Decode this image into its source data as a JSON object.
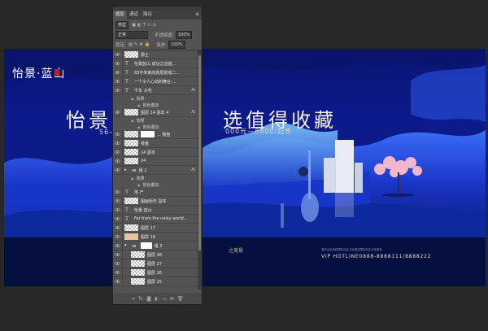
{
  "panel": {
    "tabs": [
      "图层",
      "通道",
      "路径"
    ],
    "filter_kind": "类型",
    "blend_mode": "正常",
    "opacity_label": "不透明度:",
    "opacity_value": "100%",
    "lock_label": "锁定:",
    "fill_label": "填充:",
    "fill_value": "100%",
    "layers": [
      {
        "name": "爵士",
        "type": "thumb"
      },
      {
        "name": "怡景蓝山 成功之选值...",
        "type": "T"
      },
      {
        "name": "83平米南向高层景观二...",
        "type": "T"
      },
      {
        "name": "一个令人心动的舞台-...",
        "type": "T"
      },
      {
        "name": "千年 大宅",
        "type": "T",
        "fx": true
      },
      {
        "name": "效果",
        "type": "sub"
      },
      {
        "name": "颜色叠加",
        "type": "sub2"
      },
      {
        "name": "图层 14 副本 4",
        "type": "thumb",
        "fx": true
      },
      {
        "name": "效果",
        "type": "sub"
      },
      {
        "name": "颜色叠加",
        "type": "sub2"
      },
      {
        "name": "...  楼盘",
        "type": "thumbwhite"
      },
      {
        "name": "楼盘",
        "type": "thumb"
      },
      {
        "name": "24 副本",
        "type": "thumb"
      },
      {
        "name": "24",
        "type": "thumb"
      },
      {
        "name": "组 2",
        "type": "group",
        "fx": true
      },
      {
        "name": "效果",
        "type": "sub"
      },
      {
        "name": "颜色叠加",
        "type": "sub2"
      },
      {
        "name": "地 产",
        "type": "T"
      },
      {
        "name": "图画矩形 副本",
        "type": "thumb"
      },
      {
        "name": "怡景·蓝山",
        "type": "T"
      },
      {
        "name": "Far from the noisy world...",
        "type": "T"
      },
      {
        "name": "图层 17",
        "type": "thumb"
      },
      {
        "name": "图层 18",
        "type": "thumbtan"
      },
      {
        "name": "组 3",
        "type": "group2"
      },
      {
        "name": "图层 28",
        "type": "thumbindent"
      },
      {
        "name": "图层 27",
        "type": "thumbindent"
      },
      {
        "name": "图层 26",
        "type": "thumbindent"
      },
      {
        "name": "图层 25",
        "type": "thumbindent"
      }
    ]
  },
  "artwork": {
    "brand": "怡景·蓝山",
    "headline_left": "怡景蓝",
    "headline_right": "选值得收藏",
    "price_left": "56—1",
    "price_right": "000元—6800/起售",
    "small_right_top": "之美景",
    "hotline": "VIP HOTLINE0888-8888111/8888222",
    "fine_print": "湖光山色地段国际社区占地规划国际社区占地规划"
  }
}
